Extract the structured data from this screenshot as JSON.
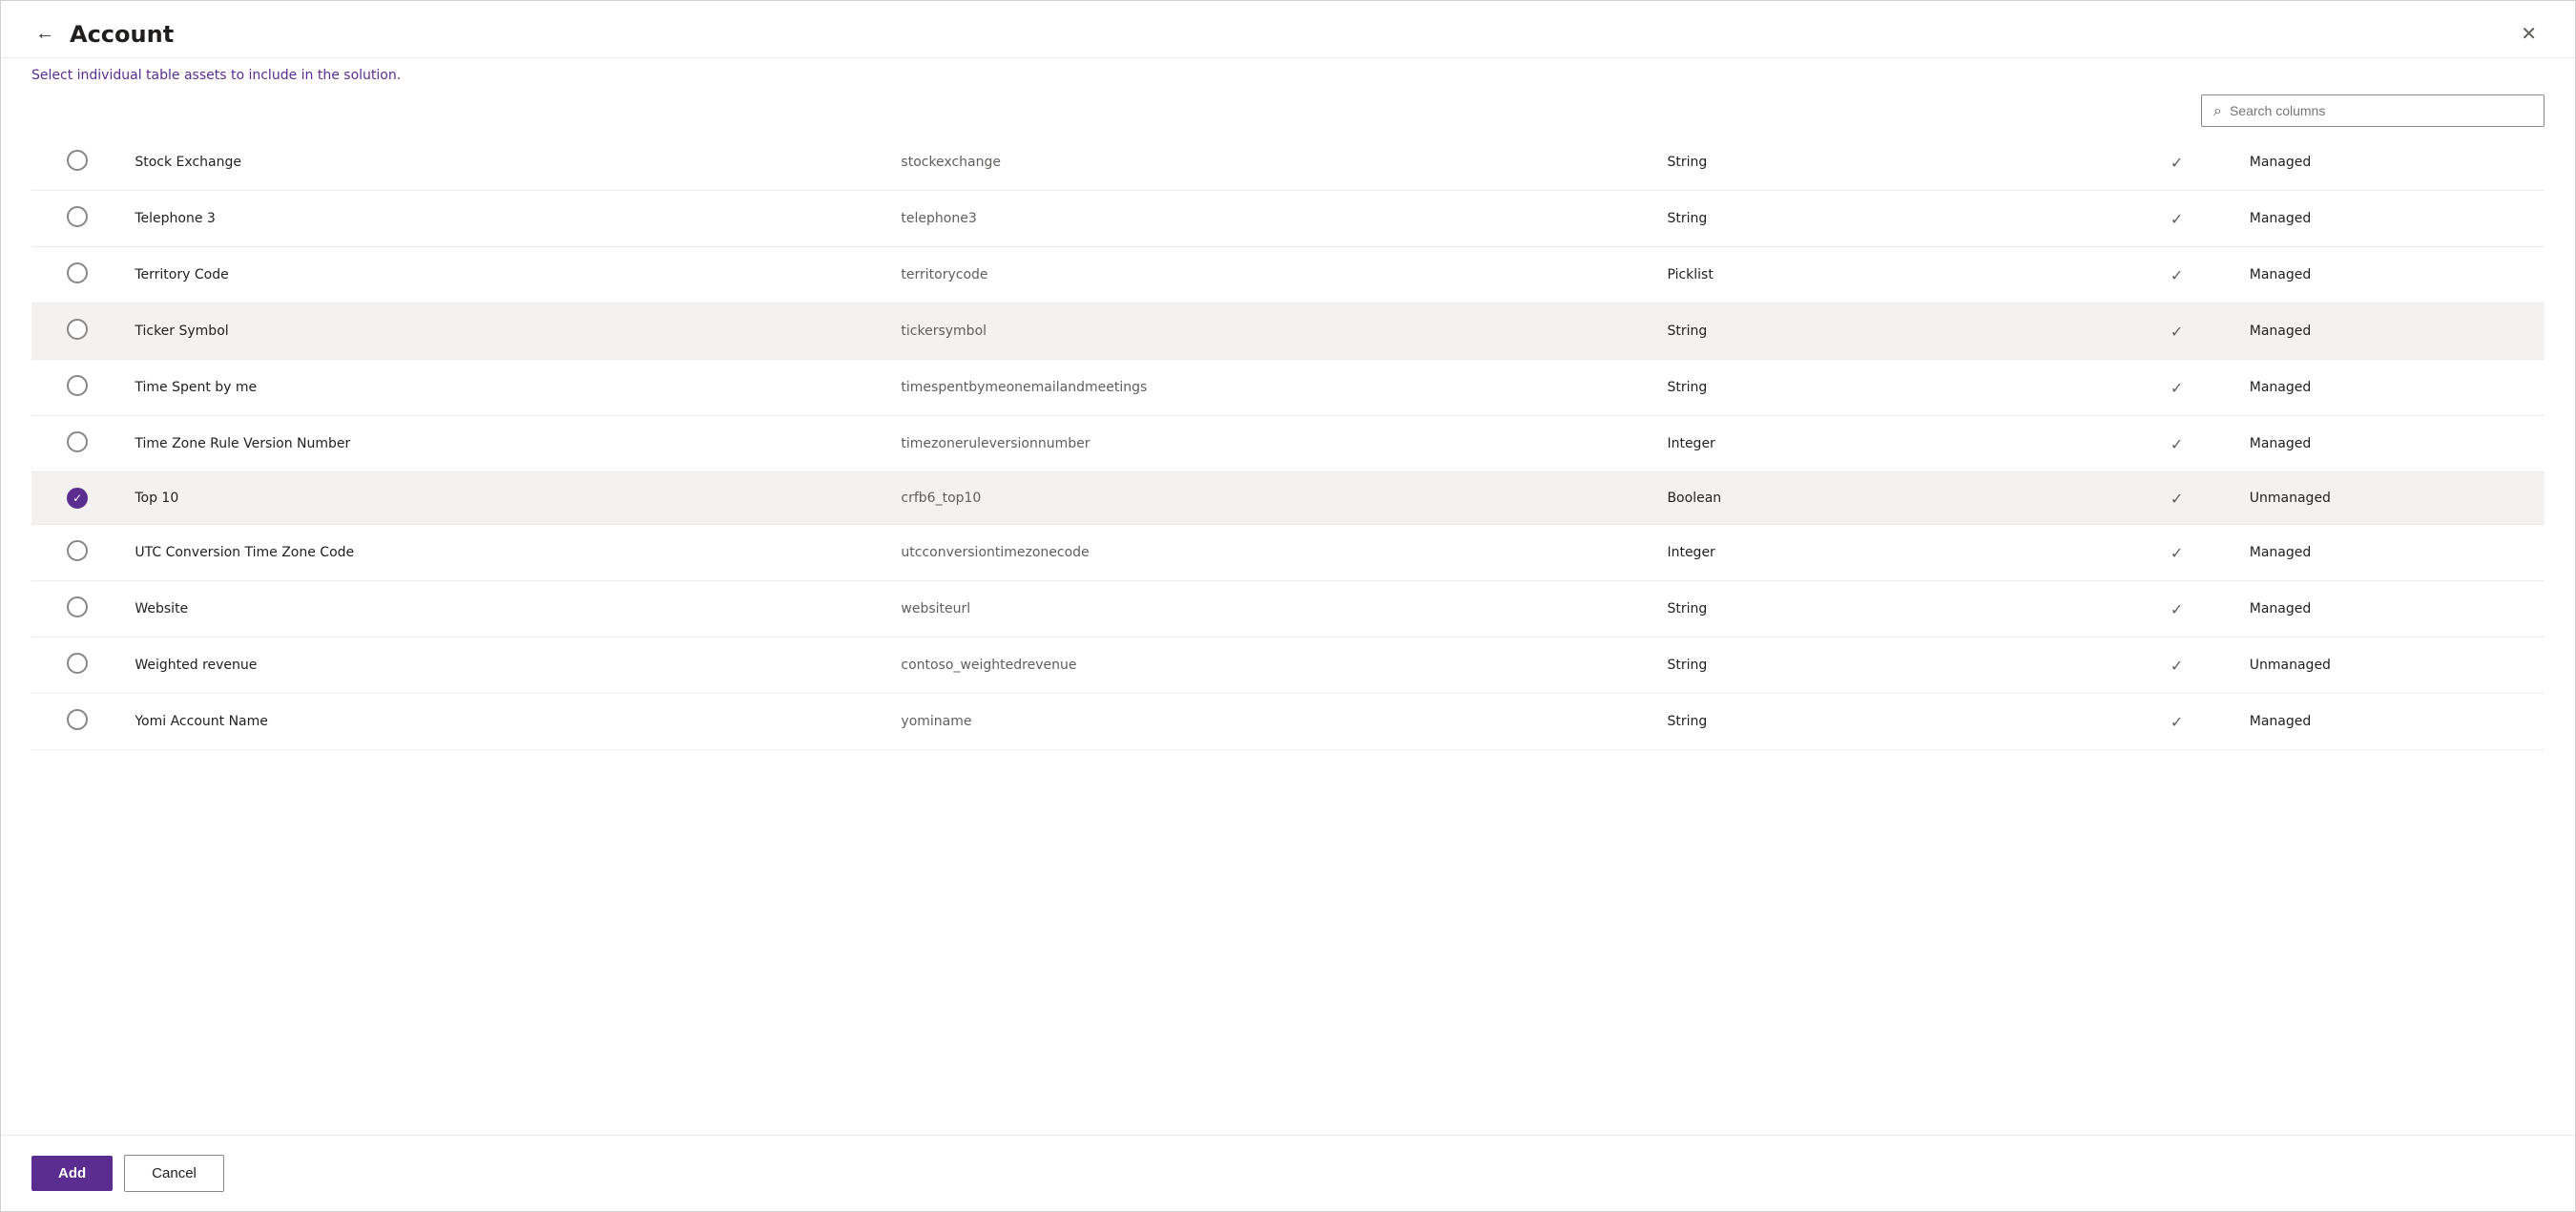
{
  "header": {
    "title": "Account",
    "subtitle_static": "Select ",
    "subtitle_link": "individual table assets",
    "subtitle_rest": " to include in the solution.",
    "back_label": "←",
    "close_label": "✕"
  },
  "search": {
    "placeholder": "Search columns",
    "icon": "🔍"
  },
  "rows": [
    {
      "id": 1,
      "name": "Stock Exchange",
      "logical": "stockexchange",
      "type": "String",
      "managed": "Managed",
      "selected": false
    },
    {
      "id": 2,
      "name": "Telephone 3",
      "logical": "telephone3",
      "type": "String",
      "managed": "Managed",
      "selected": false
    },
    {
      "id": 3,
      "name": "Territory Code",
      "logical": "territorycode",
      "type": "Picklist",
      "managed": "Managed",
      "selected": false
    },
    {
      "id": 4,
      "name": "Ticker Symbol",
      "logical": "tickersymbol",
      "type": "String",
      "managed": "Managed",
      "selected": false,
      "highlighted": true
    },
    {
      "id": 5,
      "name": "Time Spent by me",
      "logical": "timespentbymeonemailandmeetings",
      "type": "String",
      "managed": "Managed",
      "selected": false
    },
    {
      "id": 6,
      "name": "Time Zone Rule Version Number",
      "logical": "timezoneruleversionnumber",
      "type": "Integer",
      "managed": "Managed",
      "selected": false
    },
    {
      "id": 7,
      "name": "Top 10",
      "logical": "crfb6_top10",
      "type": "Boolean",
      "managed": "Unmanaged",
      "selected": true,
      "highlighted": true
    },
    {
      "id": 8,
      "name": "UTC Conversion Time Zone Code",
      "logical": "utcconversiontimezonecode",
      "type": "Integer",
      "managed": "Managed",
      "selected": false
    },
    {
      "id": 9,
      "name": "Website",
      "logical": "websiteurl",
      "type": "String",
      "managed": "Managed",
      "selected": false
    },
    {
      "id": 10,
      "name": "Weighted revenue",
      "logical": "contoso_weightedrevenue",
      "type": "String",
      "managed": "Unmanaged",
      "selected": false
    },
    {
      "id": 11,
      "name": "Yomi Account Name",
      "logical": "yominame",
      "type": "String",
      "managed": "Managed",
      "selected": false
    }
  ],
  "footer": {
    "add_label": "Add",
    "cancel_label": "Cancel"
  }
}
